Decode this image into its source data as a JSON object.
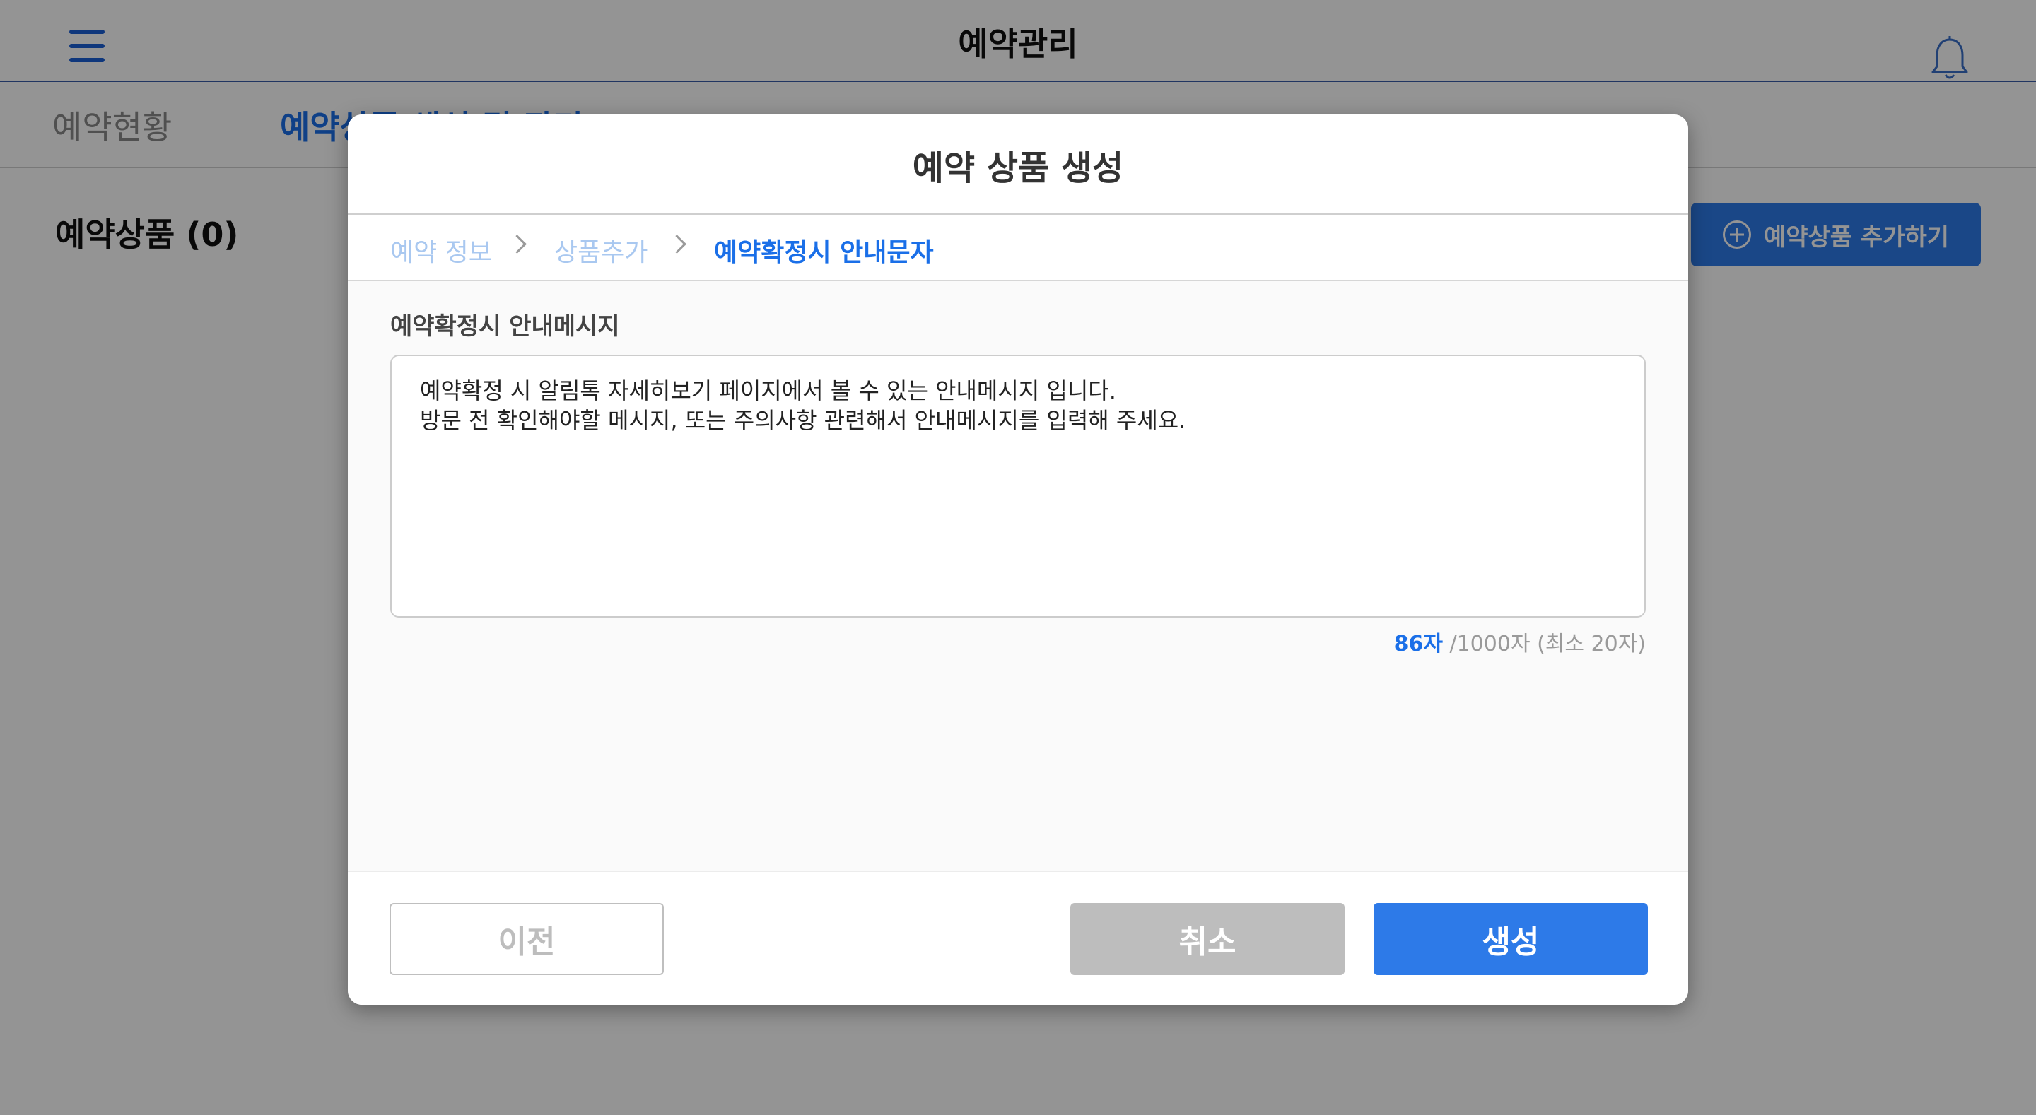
{
  "app": {
    "title": "예약관리",
    "tabs": [
      {
        "label": "예약현황"
      },
      {
        "label": "예약상품 생성 및 관리"
      }
    ],
    "section_title": "예약상품 (0)",
    "add_button_label": "예약상품 추가하기",
    "icons": {
      "menu": "hamburger-icon",
      "notifications": "bell-icon",
      "add": "plus-circle-icon"
    }
  },
  "modal": {
    "title": "예약 상품 생성",
    "steps": [
      {
        "label": "예약 정보"
      },
      {
        "label": "상품추가"
      },
      {
        "label": "예약확정시 안내문자"
      }
    ],
    "field_label": "예약확정시 안내메시지",
    "message_lines": [
      "예약확정 시 알림톡 자세히보기 페이지에서 볼 수 있는 안내메시지 입니다.",
      "방문 전 확인해야할 메시지, 또는 주의사항 관련해서 안내메시지를 입력해 주세요."
    ],
    "char_count": {
      "current": "86자",
      "rest": " /1000자 (최소 20자)"
    },
    "buttons": {
      "prev": "이전",
      "cancel": "취소",
      "create": "생성"
    }
  },
  "colors": {
    "accent": "#2d7ae8",
    "active_tab": "#1a6fe8",
    "disabled": "#bdbdbd"
  }
}
